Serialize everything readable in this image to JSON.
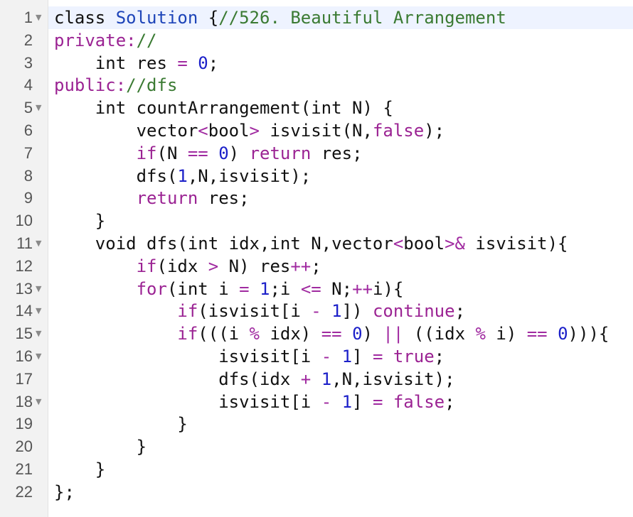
{
  "editor": {
    "lines": [
      {
        "n": "1",
        "fold": true,
        "tokens": [
          [
            "ty",
            "class "
          ],
          [
            "cls",
            "Solution"
          ],
          [
            "ty",
            " {"
          ],
          [
            "cm",
            "//526. Beautiful Arrangement"
          ]
        ]
      },
      {
        "n": "2",
        "fold": false,
        "tokens": [
          [
            "kw",
            "private:"
          ],
          [
            "cm",
            "//"
          ]
        ]
      },
      {
        "n": "3",
        "fold": false,
        "tokens": [
          [
            "ty",
            "    int res "
          ],
          [
            "op",
            "="
          ],
          [
            "ty",
            " "
          ],
          [
            "num",
            "0"
          ],
          [
            "ty",
            ";"
          ]
        ]
      },
      {
        "n": "4",
        "fold": false,
        "tokens": [
          [
            "kw",
            "public:"
          ],
          [
            "cm",
            "//dfs"
          ]
        ]
      },
      {
        "n": "5",
        "fold": true,
        "tokens": [
          [
            "ty",
            "    int countArrangement(int N) {"
          ]
        ]
      },
      {
        "n": "6",
        "fold": false,
        "tokens": [
          [
            "ty",
            "        vector"
          ],
          [
            "op",
            "<"
          ],
          [
            "ty",
            "bool"
          ],
          [
            "op",
            ">"
          ],
          [
            "ty",
            " isvisit(N,"
          ],
          [
            "lit",
            "false"
          ],
          [
            "ty",
            ");"
          ]
        ]
      },
      {
        "n": "7",
        "fold": false,
        "tokens": [
          [
            "ty",
            "        "
          ],
          [
            "kw",
            "if"
          ],
          [
            "ty",
            "(N "
          ],
          [
            "op",
            "=="
          ],
          [
            "ty",
            " "
          ],
          [
            "num",
            "0"
          ],
          [
            "ty",
            ") "
          ],
          [
            "kw",
            "return"
          ],
          [
            "ty",
            " res;"
          ]
        ]
      },
      {
        "n": "8",
        "fold": false,
        "tokens": [
          [
            "ty",
            "        dfs("
          ],
          [
            "num",
            "1"
          ],
          [
            "ty",
            ",N,isvisit);"
          ]
        ]
      },
      {
        "n": "9",
        "fold": false,
        "tokens": [
          [
            "ty",
            "        "
          ],
          [
            "kw",
            "return"
          ],
          [
            "ty",
            " res;"
          ]
        ]
      },
      {
        "n": "10",
        "fold": false,
        "tokens": [
          [
            "ty",
            "    }"
          ]
        ]
      },
      {
        "n": "11",
        "fold": true,
        "tokens": [
          [
            "ty",
            "    void dfs(int idx,int N,vector"
          ],
          [
            "op",
            "<"
          ],
          [
            "ty",
            "bool"
          ],
          [
            "op",
            ">&"
          ],
          [
            "ty",
            " isvisit){"
          ]
        ]
      },
      {
        "n": "12",
        "fold": false,
        "tokens": [
          [
            "ty",
            "        "
          ],
          [
            "kw",
            "if"
          ],
          [
            "ty",
            "(idx "
          ],
          [
            "op",
            ">"
          ],
          [
            "ty",
            " N) res"
          ],
          [
            "op",
            "++"
          ],
          [
            "ty",
            ";"
          ]
        ]
      },
      {
        "n": "13",
        "fold": true,
        "tokens": [
          [
            "ty",
            "        "
          ],
          [
            "kw",
            "for"
          ],
          [
            "ty",
            "(int i "
          ],
          [
            "op",
            "="
          ],
          [
            "ty",
            " "
          ],
          [
            "num",
            "1"
          ],
          [
            "ty",
            ";i "
          ],
          [
            "op",
            "<="
          ],
          [
            "ty",
            " N;"
          ],
          [
            "op",
            "++"
          ],
          [
            "ty",
            "i){"
          ]
        ]
      },
      {
        "n": "14",
        "fold": true,
        "tokens": [
          [
            "ty",
            "            "
          ],
          [
            "kw",
            "if"
          ],
          [
            "ty",
            "(isvisit[i "
          ],
          [
            "op",
            "-"
          ],
          [
            "ty",
            " "
          ],
          [
            "num",
            "1"
          ],
          [
            "ty",
            "]) "
          ],
          [
            "kw",
            "continue"
          ],
          [
            "ty",
            ";"
          ]
        ]
      },
      {
        "n": "15",
        "fold": true,
        "tokens": [
          [
            "ty",
            "            "
          ],
          [
            "kw",
            "if"
          ],
          [
            "ty",
            "(((i "
          ],
          [
            "op",
            "%"
          ],
          [
            "ty",
            " idx) "
          ],
          [
            "op",
            "=="
          ],
          [
            "ty",
            " "
          ],
          [
            "num",
            "0"
          ],
          [
            "ty",
            ") "
          ],
          [
            "op",
            "||"
          ],
          [
            "ty",
            " ((idx "
          ],
          [
            "op",
            "%"
          ],
          [
            "ty",
            " i) "
          ],
          [
            "op",
            "=="
          ],
          [
            "ty",
            " "
          ],
          [
            "num",
            "0"
          ],
          [
            "ty",
            "))){"
          ]
        ]
      },
      {
        "n": "16",
        "fold": true,
        "tokens": [
          [
            "ty",
            "                isvisit[i "
          ],
          [
            "op",
            "-"
          ],
          [
            "ty",
            " "
          ],
          [
            "num",
            "1"
          ],
          [
            "ty",
            "] "
          ],
          [
            "op",
            "="
          ],
          [
            "ty",
            " "
          ],
          [
            "lit",
            "true"
          ],
          [
            "ty",
            ";"
          ]
        ]
      },
      {
        "n": "17",
        "fold": false,
        "tokens": [
          [
            "ty",
            "                dfs(idx "
          ],
          [
            "op",
            "+"
          ],
          [
            "ty",
            " "
          ],
          [
            "num",
            "1"
          ],
          [
            "ty",
            ",N,isvisit);"
          ]
        ]
      },
      {
        "n": "18",
        "fold": true,
        "tokens": [
          [
            "ty",
            "                isvisit[i "
          ],
          [
            "op",
            "-"
          ],
          [
            "ty",
            " "
          ],
          [
            "num",
            "1"
          ],
          [
            "ty",
            "] "
          ],
          [
            "op",
            "="
          ],
          [
            "ty",
            " "
          ],
          [
            "lit",
            "false"
          ],
          [
            "ty",
            ";"
          ]
        ]
      },
      {
        "n": "19",
        "fold": false,
        "tokens": [
          [
            "ty",
            "            }"
          ]
        ]
      },
      {
        "n": "20",
        "fold": false,
        "tokens": [
          [
            "ty",
            "        }"
          ]
        ]
      },
      {
        "n": "21",
        "fold": false,
        "tokens": [
          [
            "ty",
            "    }"
          ]
        ]
      },
      {
        "n": "22",
        "fold": false,
        "tokens": [
          [
            "ty",
            "};"
          ]
        ]
      }
    ]
  },
  "icons": {
    "fold_marker": "chevron-down-icon"
  },
  "colors": {
    "keyword": "#9b2393",
    "class_name": "#1d44b8",
    "comment": "#3a7a32",
    "number": "#1c20c9",
    "operator": "#a02aa0",
    "gutter_bg": "#f2f2f2",
    "active_line_bg": "#eef3ff"
  }
}
